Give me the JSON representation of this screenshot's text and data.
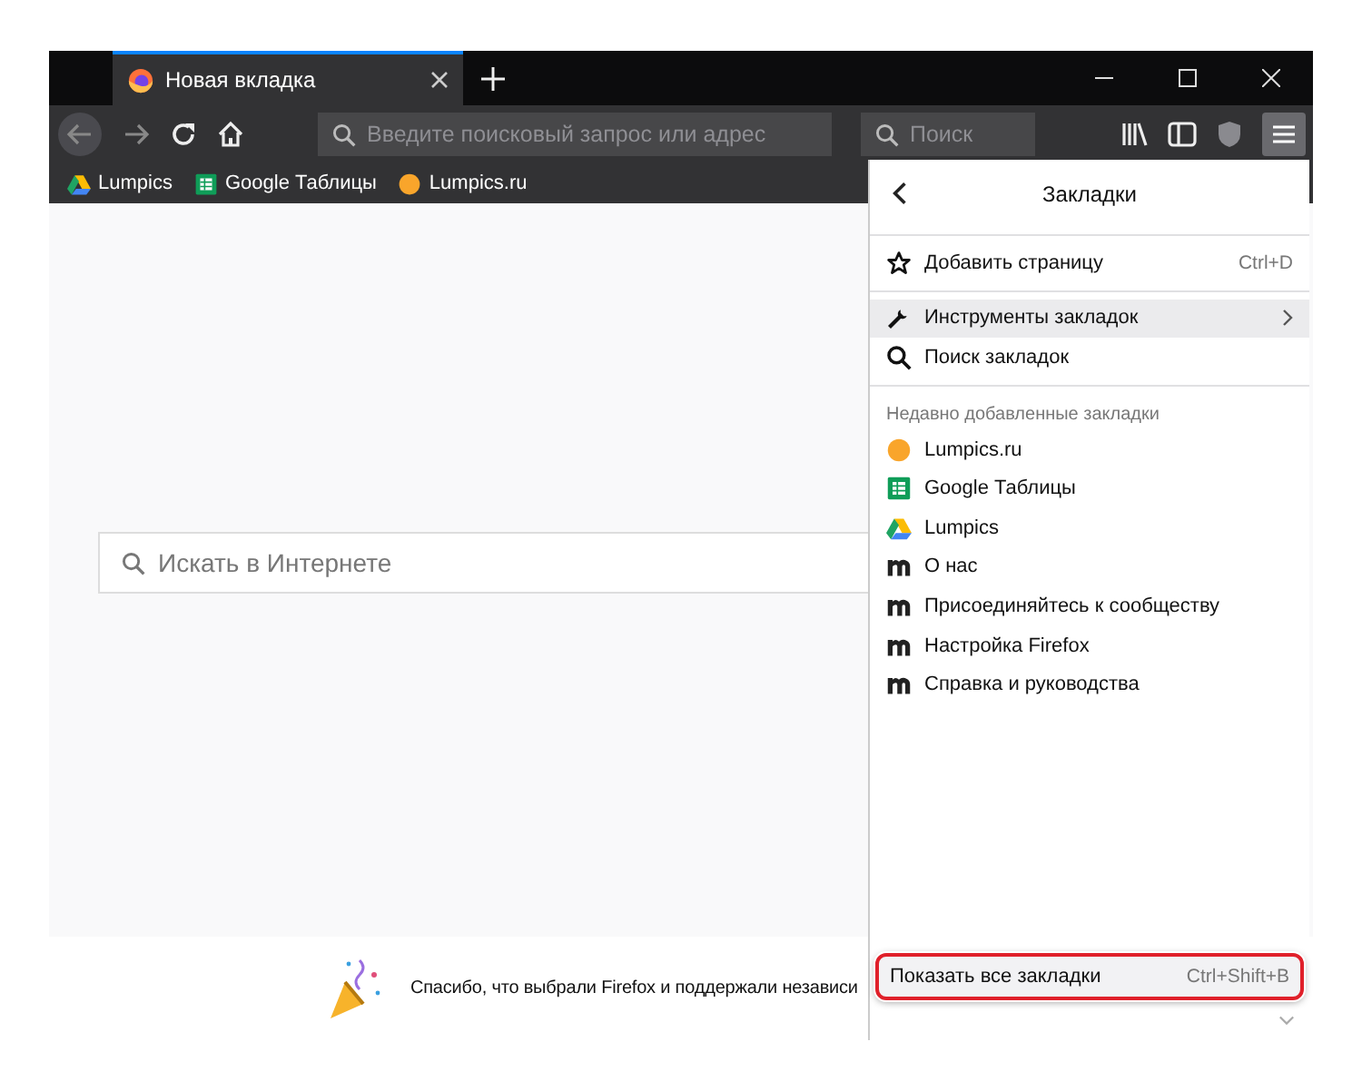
{
  "tabs": [
    {
      "title": "Новая вкладка",
      "selected": true
    }
  ],
  "toolbar": {
    "address_placeholder": "Введите поисковый запрос или адрес",
    "search_placeholder": "Поиск",
    "menu_open": true
  },
  "bookmarks_bar": [
    {
      "label": "Lumpics",
      "kind": "drive"
    },
    {
      "label": "Google Таблицы",
      "kind": "sheet"
    },
    {
      "label": "Lumpics.ru",
      "kind": "dot"
    }
  ],
  "page": {
    "search_placeholder": "Искать в Интернете",
    "footer_text": "Спасибо, что выбрали Firefox и поддержали независи"
  },
  "menu": {
    "title": "Закладки",
    "actions": [
      {
        "label": "Добавить страницу",
        "shortcut": "Ctrl+D",
        "kind": "star",
        "highlighted": false,
        "submenu": false
      },
      {
        "label": "Инструменты закладок",
        "kind": "wrench",
        "highlighted": true,
        "submenu": true
      },
      {
        "label": "Поиск закладок",
        "kind": "search",
        "highlighted": false,
        "submenu": false
      }
    ],
    "recent_heading": "Недавно добавленные закладки",
    "recent": [
      {
        "label": "Lumpics.ru",
        "kind": "dot"
      },
      {
        "label": "Google Таблицы",
        "kind": "sheet"
      },
      {
        "label": "Lumpics",
        "kind": "drive"
      },
      {
        "label": "О нас",
        "kind": "m"
      },
      {
        "label": "Присоединяйтесь к сообществу",
        "kind": "m"
      },
      {
        "label": "Настройка Firefox",
        "kind": "m"
      },
      {
        "label": "Справка и руководства",
        "kind": "m"
      }
    ],
    "show_all": {
      "label": "Показать все закладки",
      "shortcut": "Ctrl+Shift+B",
      "annotated": true
    }
  }
}
